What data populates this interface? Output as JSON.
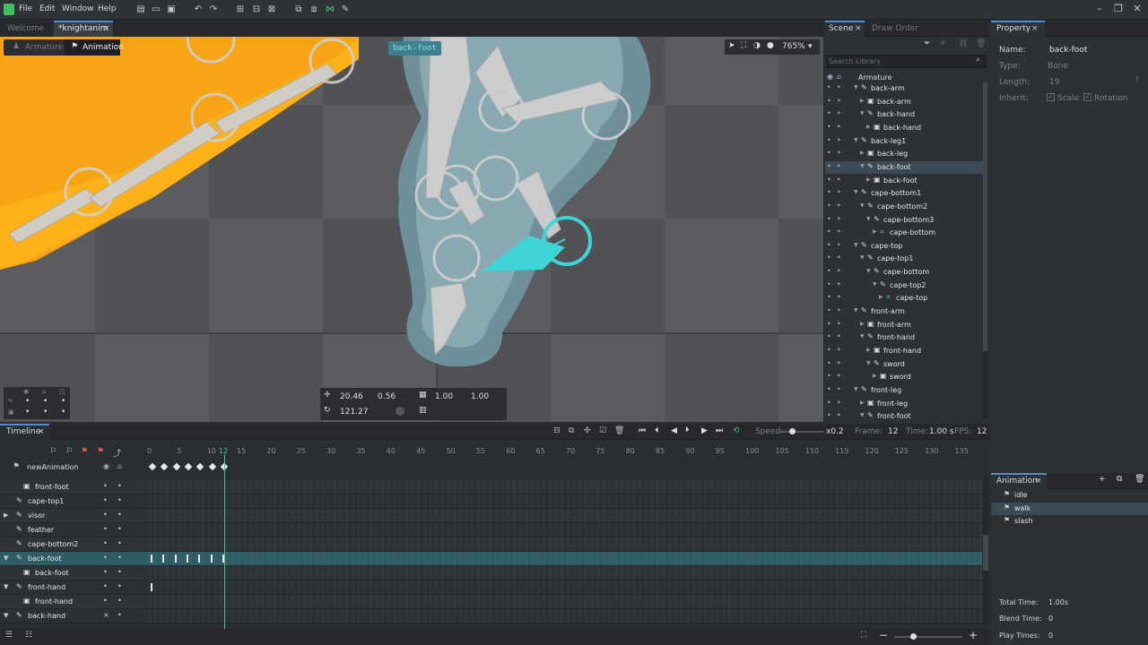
{
  "menu": {
    "file": "File",
    "edit": "Edit",
    "window": "Window",
    "help": "Help"
  },
  "doc_tabs": {
    "welcome": "Welcome",
    "active": "*knightanim"
  },
  "mode": {
    "armature": "Armature",
    "animation": "Animation"
  },
  "viewport": {
    "selected_label": "back-foot",
    "zoom": "765%"
  },
  "transform": {
    "x": "20.46",
    "y": "0.56",
    "sx": "1.00",
    "sy": "1.00",
    "rot": "121.27"
  },
  "scene": {
    "tab_scene": "Scene",
    "tab_draw_order": "Draw Order",
    "search_placeholder": "Search Library",
    "root": "Armature",
    "items": [
      {
        "label": "back-arm",
        "kind": "bone",
        "indent": 0
      },
      {
        "label": "back-arm",
        "kind": "slot",
        "indent": 1
      },
      {
        "label": "back-hand",
        "kind": "bone",
        "indent": 1
      },
      {
        "label": "back-hand",
        "kind": "slot",
        "indent": 2
      },
      {
        "label": "back-leg1",
        "kind": "bone",
        "indent": 0
      },
      {
        "label": "back-leg",
        "kind": "slot",
        "indent": 1
      },
      {
        "label": "back-foot",
        "kind": "bone",
        "indent": 1,
        "selected": true
      },
      {
        "label": "back-foot",
        "kind": "slot",
        "indent": 2
      },
      {
        "label": "cape-bottom1",
        "kind": "bone",
        "indent": 0
      },
      {
        "label": "cape-bottom2",
        "kind": "bone",
        "indent": 1
      },
      {
        "label": "cape-bottom3",
        "kind": "bone",
        "indent": 2
      },
      {
        "label": "cape-bottom",
        "kind": "mesh",
        "indent": 3
      },
      {
        "label": "cape-top",
        "kind": "bone",
        "indent": 0
      },
      {
        "label": "cape-top1",
        "kind": "bone",
        "indent": 1
      },
      {
        "label": "cape-bottom",
        "kind": "bone",
        "indent": 2
      },
      {
        "label": "cape-top2",
        "kind": "bone",
        "indent": 3
      },
      {
        "label": "cape-top",
        "kind": "mesh",
        "indent": 4
      },
      {
        "label": "front-arm",
        "kind": "bone",
        "indent": 0
      },
      {
        "label": "front-arm",
        "kind": "slot",
        "indent": 1
      },
      {
        "label": "front-hand",
        "kind": "bone",
        "indent": 1
      },
      {
        "label": "front-hand",
        "kind": "slot",
        "indent": 2
      },
      {
        "label": "sword",
        "kind": "bone",
        "indent": 2
      },
      {
        "label": "sword",
        "kind": "slot",
        "indent": 3
      },
      {
        "label": "front-leg",
        "kind": "bone",
        "indent": 0
      },
      {
        "label": "front-leg",
        "kind": "slot",
        "indent": 1
      },
      {
        "label": "front-foot",
        "kind": "bone",
        "indent": 1
      }
    ]
  },
  "property": {
    "tab": "Property",
    "name_label": "Name:",
    "name_value": "back-foot",
    "type_label": "Type:",
    "type_value": "Bone",
    "length_label": "Length:",
    "length_value": "19",
    "inherit_label": "Inherit:",
    "scale": "Scale",
    "rotation": "Rotation"
  },
  "animation_panel": {
    "tab": "Animation",
    "items": [
      {
        "label": "idle"
      },
      {
        "label": "walk",
        "selected": true
      },
      {
        "label": "slash"
      }
    ],
    "total_time_label": "Total Time:",
    "total_time": "1.00s",
    "blend_time_label": "Blend Time:",
    "blend_time": "0",
    "play_times_label": "Play Times:",
    "play_times": "0"
  },
  "timeline": {
    "tab": "Timeline",
    "speed_label": "Speed:",
    "speed_value": "x0.2",
    "frame_label": "Frame:",
    "frame_value": "12",
    "time_label": "Time:",
    "time_value": "1.00 s",
    "fps_label": "FPS:",
    "fps_value": "12",
    "ticks": [
      "0",
      "5",
      "10",
      "12",
      "15",
      "20",
      "25",
      "30",
      "35",
      "40",
      "45",
      "50",
      "55",
      "60",
      "65",
      "70",
      "75",
      "80",
      "85",
      "90",
      "95",
      "100",
      "105",
      "110",
      "115",
      "120",
      "125",
      "130",
      "135"
    ],
    "current_frame": 12,
    "animation_name": "newAnimation",
    "rows": [
      {
        "label": "front-foot",
        "kind": "slot",
        "expand": false,
        "visible": "•",
        "lock": "•"
      },
      {
        "label": "cape-top1",
        "kind": "bone",
        "expand": false,
        "visible": "•",
        "lock": "•"
      },
      {
        "label": "visor",
        "kind": "bone",
        "expand": true,
        "visible": "•",
        "lock": "•"
      },
      {
        "label": "feather",
        "kind": "bone",
        "expand": false,
        "visible": "•",
        "lock": "•"
      },
      {
        "label": "cape-bottom2",
        "kind": "bone",
        "expand": false,
        "visible": "•",
        "lock": "•"
      },
      {
        "label": "back-foot",
        "kind": "bone",
        "expand": true,
        "selected": true,
        "visible": "•",
        "lock": "•"
      },
      {
        "label": "back-foot",
        "kind": "slot",
        "expand": false,
        "visible": "•",
        "lock": "•"
      },
      {
        "label": "front-hand",
        "kind": "bone",
        "expand": true,
        "visible": "•",
        "lock": "•"
      },
      {
        "label": "front-hand",
        "kind": "slot",
        "expand": false,
        "visible": "•",
        "lock": "•"
      },
      {
        "label": "back-hand",
        "kind": "bone",
        "expand": true,
        "visible": "×",
        "lock": "•"
      }
    ]
  }
}
